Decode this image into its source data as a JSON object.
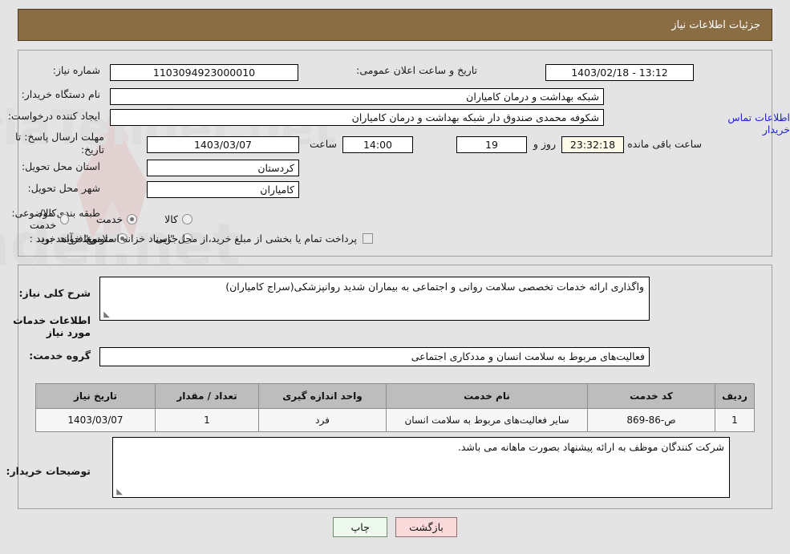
{
  "header": {
    "title": "جزئیات اطلاعات نیاز"
  },
  "top": {
    "need_number_label": "شماره نیاز:",
    "need_number_value": "1103094923000010",
    "announce_label": "تاریخ و ساعت اعلان عمومی:",
    "announce_value": "13:12 - 1403/02/18",
    "buyer_org_label": "نام دستگاه خریدار:",
    "buyer_org_value": "شبکه بهداشت و درمان کامیاران",
    "creator_label": "ایجاد کننده درخواست:",
    "creator_value": "شکوفه محمدی صندوق دار شبکه بهداشت و درمان کامیاران",
    "contact_link": "اطلاعات تماس خریدار",
    "deadline_label": "مهلت ارسال پاسخ: تا تاریخ:",
    "deadline_date": "1403/03/07",
    "hour_label": "ساعت",
    "deadline_time": "14:00",
    "days_value": "19",
    "days_and_label": "روز و",
    "countdown_value": "23:32:18",
    "remaining_label": "ساعت باقی مانده",
    "province_label": "استان محل تحویل:",
    "province_value": "کردستان",
    "city_label": "شهر محل تحویل:",
    "city_value": "کامیاران",
    "category_label": "طبقه بندی موضوعی:",
    "category_options": [
      {
        "label": "کالا",
        "selected": false
      },
      {
        "label": "خدمت",
        "selected": true
      },
      {
        "label": "کالا/خدمت",
        "selected": false
      }
    ],
    "process_label": "نوع فرآیند خرید :",
    "process_options": [
      {
        "label": "جزیی",
        "selected": false
      },
      {
        "label": "متوسط",
        "selected": true
      }
    ],
    "payment_checkbox_label": "پرداخت تمام یا بخشی از مبلغ خرید،از محل \"اسناد خزانه اسلامی\" خواهد بود.",
    "payment_checked": false
  },
  "middle": {
    "general_desc_label": "شرح کلی نیاز:",
    "general_desc_value": "واگذاری ارائه خدمات تخصصی سلامت روانی و اجتماعی به بیماران شدید روانپزشکی(سراج کامیاران)",
    "services_section_title": "اطلاعات خدمات مورد نیاز",
    "service_group_label": "گروه خدمت:",
    "service_group_value": "فعالیت‌های مربوط به سلامت انسان و مددکاری اجتماعی",
    "table": {
      "headers": [
        "ردیف",
        "کد خدمت",
        "نام خدمت",
        "واحد اندازه گیری",
        "تعداد / مقدار",
        "تاریخ نیاز"
      ],
      "rows": [
        [
          "1",
          "ص-86-869",
          "سایر فعالیت‌های مربوط به سلامت انسان",
          "فرد",
          "1",
          "1403/03/07"
        ]
      ]
    },
    "buyer_notes_label": "توضیحات خریدار:",
    "buyer_notes_value": "شرکت کنندگان موظف به ارائه پیشنهاد بصورت ماهانه می باشد."
  },
  "footer": {
    "print_label": "چاپ",
    "back_label": "بازگشت"
  },
  "colors": {
    "header_bg": "#8a6d42",
    "link": "#2020dd",
    "print_btn": "#eefaee",
    "back_btn": "#fadada",
    "countdown_bg": "#fdfbe8"
  }
}
